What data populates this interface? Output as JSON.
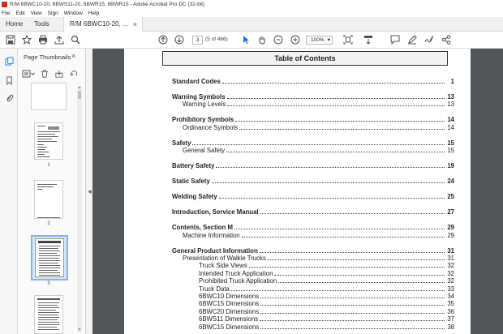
{
  "window": {
    "title": "R/M 6BWC10-20, 6BWS11-20, 6BWR15, 6BWR15 - Adobe Acrobat Pro DC (32-bit)"
  },
  "menu": [
    "File",
    "Edit",
    "View",
    "Sign",
    "Window",
    "Help"
  ],
  "tabs": {
    "home": "Home",
    "tools": "Tools",
    "document": "R/M 6BWC10-20, ...",
    "close": "×"
  },
  "toolbar": {
    "page_number": "3",
    "page_of": "(5 of 466)",
    "zoom": "100%",
    "zoom_arrow": "▾"
  },
  "icons": {
    "save": "save-icon",
    "bookmark": "star-icon",
    "print": "print-icon",
    "upload": "upload-icon",
    "search": "search-icon",
    "prev_page": "arrow-up-icon",
    "next_page": "arrow-down-icon",
    "select": "pointer-icon",
    "hand": "hand-icon",
    "zoom_out": "zoom-out-icon",
    "zoom_in": "zoom-in-icon",
    "fit": "fit-page-icon",
    "scroll_mode": "scroll-mode-icon",
    "comment": "comment-icon",
    "highlight": "pen-icon",
    "sign": "sign-icon",
    "share": "share-icon"
  },
  "sidebar": {
    "panel_title": "Page Thumbnails",
    "panel_close": "×",
    "thumbnail_labels": [
      "1",
      "2",
      "3"
    ]
  },
  "toc": {
    "header": "Table of Contents",
    "entries": [
      {
        "title": "Standard Codes",
        "page": "1",
        "level": 0
      },
      {
        "title": "Warning Symbols",
        "page": "13",
        "level": 0
      },
      {
        "title": "Warning Levels",
        "page": "13",
        "level": 1
      },
      {
        "title": "Prohibitory Symbols",
        "page": "14",
        "level": 0
      },
      {
        "title": "Ordinance Symbols",
        "page": "14",
        "level": 1
      },
      {
        "title": "Safety",
        "page": "15",
        "level": 0
      },
      {
        "title": "General Safety",
        "page": "15",
        "level": 1
      },
      {
        "title": "Battery Safety",
        "page": "19",
        "level": 0
      },
      {
        "title": "Static Safety",
        "page": "24",
        "level": 0
      },
      {
        "title": "Welding Safety",
        "page": "25",
        "level": 0
      },
      {
        "title": "Introduction, Service Manual",
        "page": "27",
        "level": 0
      },
      {
        "title": "Contents, Section M",
        "page": "29",
        "level": 0
      },
      {
        "title": "Machine Information",
        "page": "29",
        "level": 1
      },
      {
        "title": "General Product Information",
        "page": "31",
        "level": 0
      },
      {
        "title": "Presentation of Walkie Trucks",
        "page": "31",
        "level": 1
      },
      {
        "title": "Truck Side Views",
        "page": "32",
        "level": 2
      },
      {
        "title": "Intended Truck Application",
        "page": "32",
        "level": 2
      },
      {
        "title": "Prohibited Truck Application",
        "page": "32",
        "level": 2
      },
      {
        "title": "Truck Data",
        "page": "33",
        "level": 2
      },
      {
        "title": "6BWC10 Dimensions",
        "page": "34",
        "level": 2
      },
      {
        "title": "6BWC15 Dimensions",
        "page": "35",
        "level": 2
      },
      {
        "title": "6BWC20 Dimensions",
        "page": "36",
        "level": 2
      },
      {
        "title": "6BWS11 Dimensions",
        "page": "37",
        "level": 2
      },
      {
        "title": "6BWC15 Dimensions",
        "page": "38",
        "level": 2
      }
    ]
  }
}
